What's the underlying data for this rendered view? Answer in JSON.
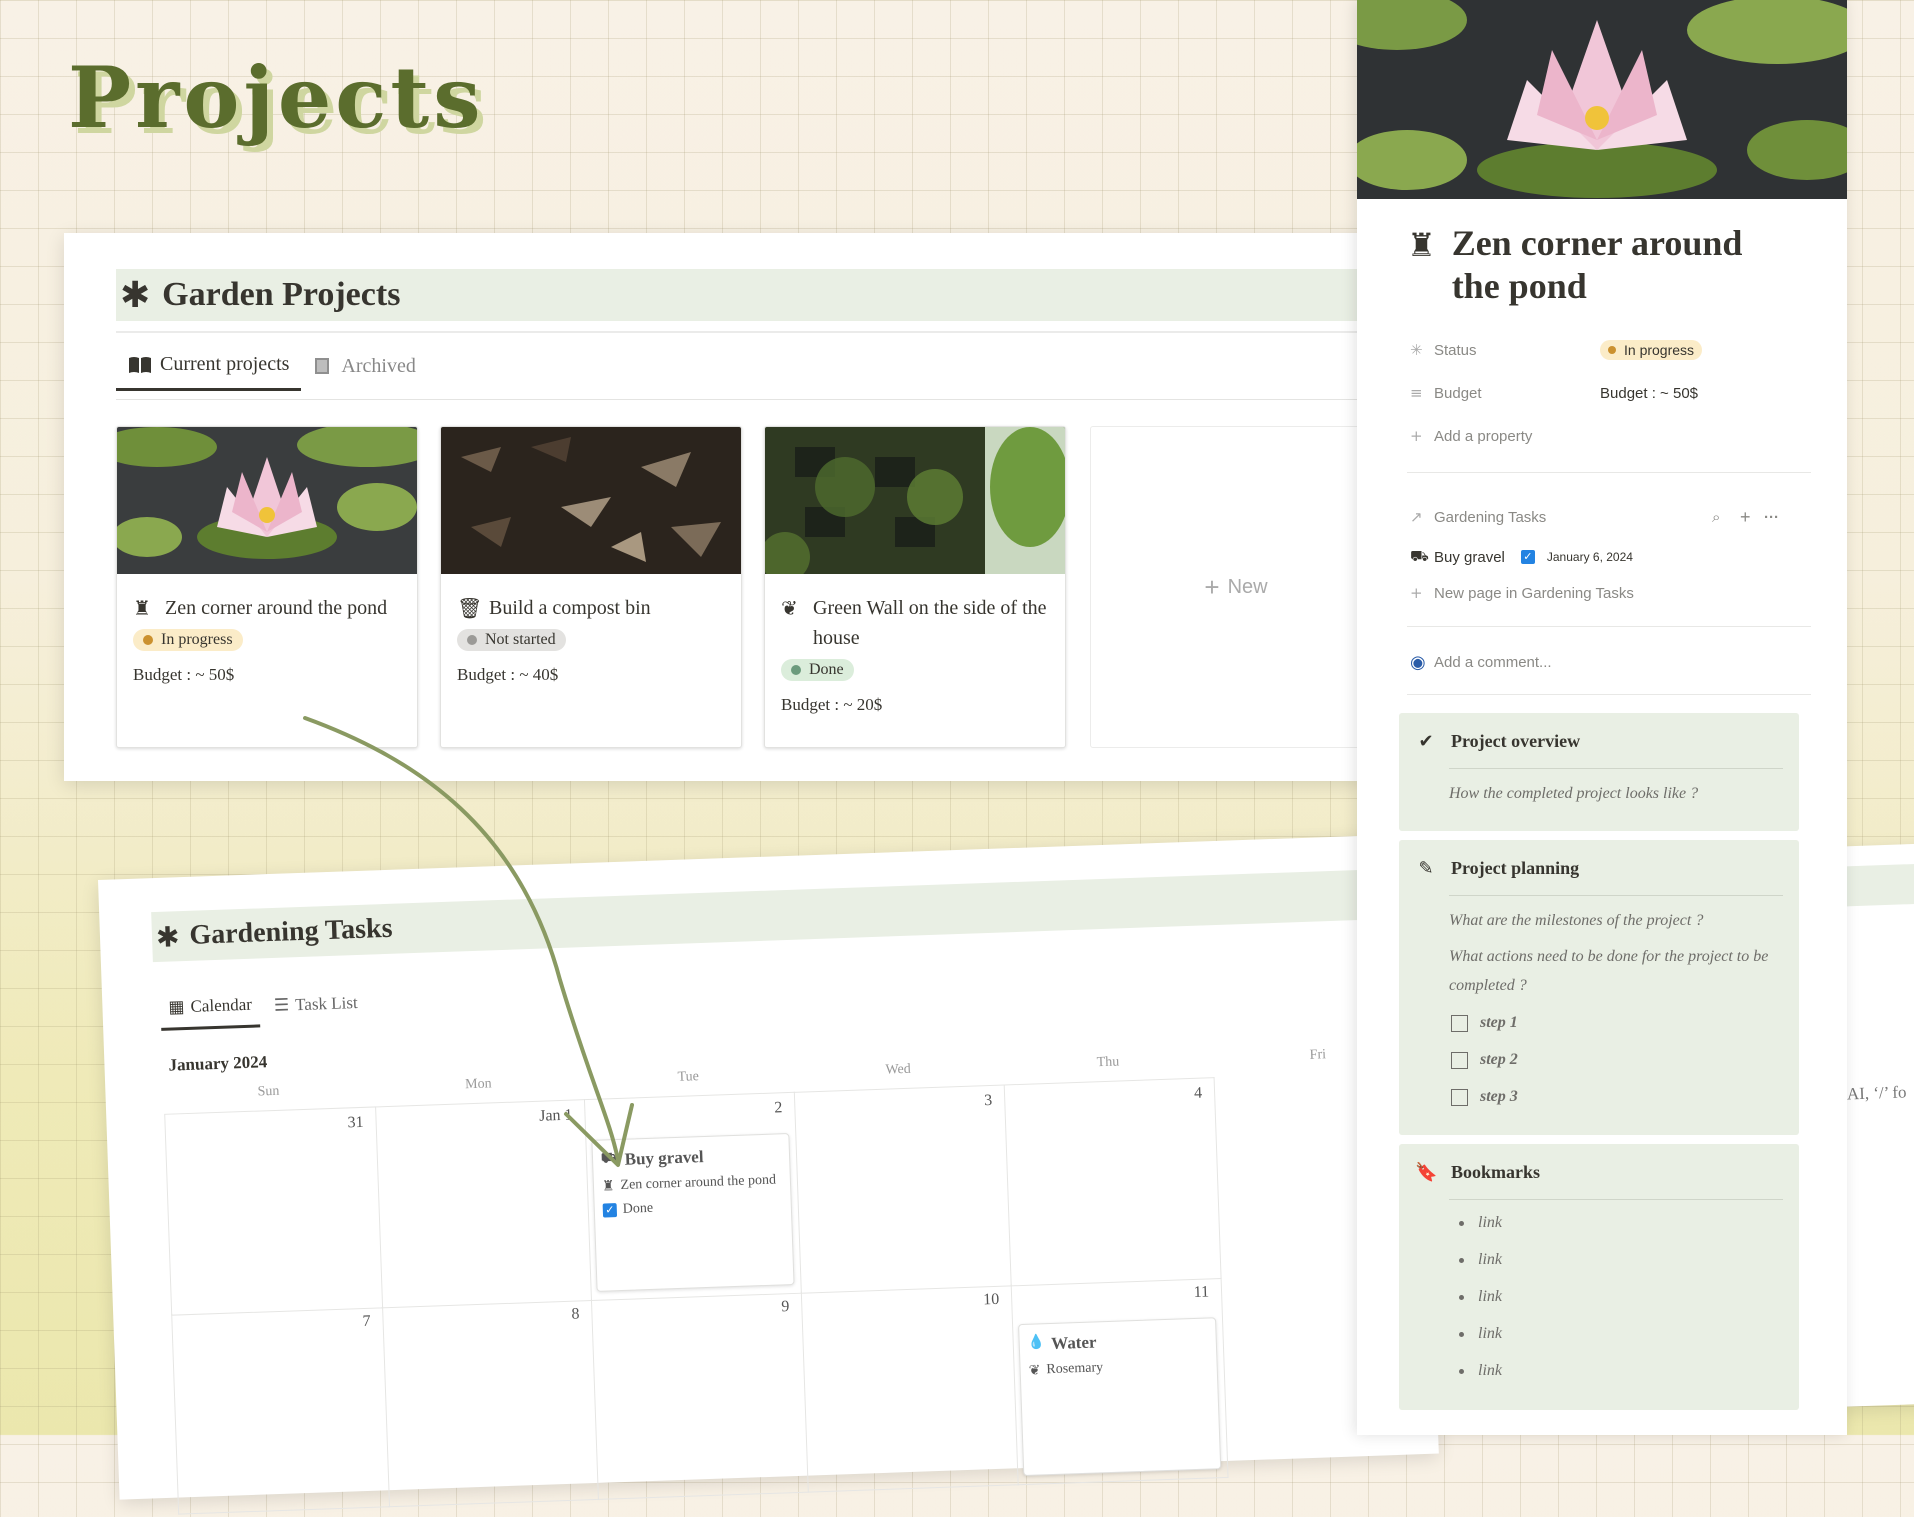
{
  "hero": {
    "title": "Projects"
  },
  "garden_projects": {
    "title": "Garden Projects",
    "tabs": [
      {
        "label": "Current projects"
      },
      {
        "label": "Archived"
      }
    ],
    "cards": [
      {
        "title": "Zen corner around the pond",
        "status": "In progress",
        "budget": "Budget : ~ 50$"
      },
      {
        "title": "Build a compost bin",
        "status": "Not started",
        "budget": "Budget : ~ 40$"
      },
      {
        "title": "Green Wall on the side of the house",
        "status": "Done",
        "budget": "Budget : ~ 20$"
      }
    ],
    "new_label": "New"
  },
  "gardening_tasks": {
    "title": "Gardening Tasks",
    "tabs": [
      {
        "label": "Calendar"
      },
      {
        "label": "Task List"
      }
    ],
    "month": "January 2024",
    "weekdays": [
      "Sun",
      "Mon",
      "Tue",
      "Wed",
      "Thu",
      "Fri"
    ],
    "week1": [
      "31",
      "Jan 1",
      "2",
      "3",
      "4"
    ],
    "week2": [
      "7",
      "8",
      "9",
      "10",
      "11"
    ],
    "event_buy_gravel": {
      "title": "Buy gravel",
      "project": "Zen corner around the pond",
      "done": "Done"
    },
    "event_water": {
      "title": "Water",
      "plant": "Rosemary"
    }
  },
  "peek": {
    "title": "Zen corner around the pond",
    "properties": {
      "status_label": "Status",
      "status_value": "In progress",
      "budget_label": "Budget",
      "budget_value": "Budget : ~ 50$",
      "add_property": "Add a property"
    },
    "relation": {
      "name": "Gardening Tasks",
      "item_title": "Buy gravel",
      "item_date": "January 6, 2024",
      "new_page": "New page in Gardening Tasks"
    },
    "comment_placeholder": "Add a comment...",
    "overview": {
      "title": "Project overview",
      "question": "How the completed project looks like ?"
    },
    "planning": {
      "title": "Project planning",
      "q1": "What are the milestones of the project ?",
      "q2": "What actions need to be done for the project to be completed ?",
      "steps": [
        "step 1",
        "step 2",
        "step 3"
      ]
    },
    "bookmarks": {
      "title": "Bookmarks",
      "links": [
        "link",
        "link",
        "link",
        "link",
        "link"
      ]
    }
  },
  "background_snippet": "AI, ‘/’ fo",
  "colors": {
    "title_green": "#5b6d2d",
    "block_bg": "#e9efe4",
    "in_progress_bg": "#fbecc8",
    "not_started_bg": "#e3e2e0",
    "done_bg": "#dbeddb",
    "checkbox_blue": "#2383e2"
  }
}
